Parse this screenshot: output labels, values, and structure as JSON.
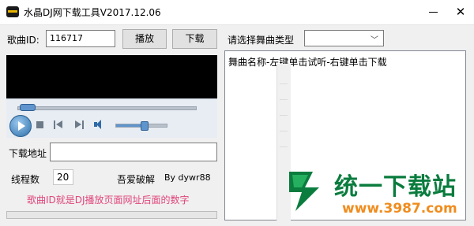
{
  "window": {
    "title": "水晶DJ网下载工具V2017.12.06",
    "minimize_icon": "minimize-icon",
    "close_label": "✕"
  },
  "form": {
    "song_id_label": "歌曲ID:",
    "song_id_value": "116717",
    "play_label": "播放",
    "download_label": "下载",
    "genre_label": "请选择舞曲类型",
    "genre_value": "",
    "download_address_label": "下载地址",
    "download_address_value": "",
    "threads_label": "线程数",
    "threads_value": "20",
    "crack_label": "吾爱破解",
    "author_label": "By dywr88",
    "hint": "歌曲ID就是DJ播放页面网址后面的数字"
  },
  "player": {
    "seek_progress": 0.03,
    "volume_level": 0.55
  },
  "list": {
    "header": "舞曲名称-左键单击试听-右键单击下载"
  },
  "watermark": {
    "title": "统一下载站",
    "url": "www.3987.com"
  },
  "colors": {
    "hint": "#e0457b",
    "watermark_green": "#0a7c3e",
    "watermark_orange": "#f08c1e"
  }
}
